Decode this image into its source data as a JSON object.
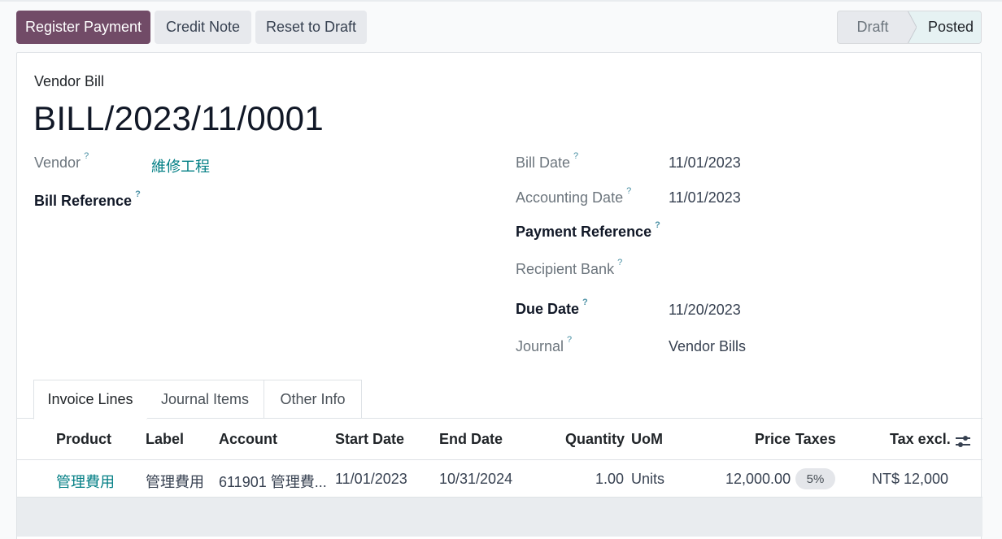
{
  "toolbar": {
    "register_payment": "Register Payment",
    "credit_note": "Credit Note",
    "reset_to_draft": "Reset to Draft"
  },
  "statusbar": {
    "stages": [
      "Draft",
      "Posted"
    ],
    "current": "Posted"
  },
  "form": {
    "subtitle": "Vendor Bill",
    "title": "BILL/2023/11/0001",
    "left_fields": {
      "vendor_label": "Vendor",
      "vendor_value": "維修工程",
      "bill_reference_label": "Bill Reference"
    },
    "right_fields": {
      "bill_date_label": "Bill Date",
      "bill_date_value": "11/01/2023",
      "accounting_date_label": "Accounting Date",
      "accounting_date_value": "11/01/2023",
      "payment_reference_label": "Payment Reference",
      "recipient_bank_label": "Recipient Bank",
      "due_date_label": "Due Date",
      "due_date_value": "11/20/2023",
      "journal_label": "Journal",
      "journal_value": "Vendor Bills"
    },
    "help_mark": "?"
  },
  "tabs": [
    "Invoice Lines",
    "Journal Items",
    "Other Info"
  ],
  "table": {
    "columns": [
      "Product",
      "Label",
      "Account",
      "Start Date",
      "End Date",
      "Quantity",
      "UoM",
      "Price",
      "Taxes",
      "Tax excl."
    ],
    "rows": [
      {
        "product": "管理費用",
        "label": "管理費用",
        "account": "611901 管理費...",
        "start_date": "11/01/2023",
        "end_date": "10/31/2024",
        "quantity": "1.00",
        "uom": "Units",
        "price": "12,000.00",
        "taxes": "5%",
        "tax_excl": "NT$ 12,000"
      }
    ]
  },
  "colors": {
    "primary": "#714b67",
    "link": "#017e84"
  }
}
